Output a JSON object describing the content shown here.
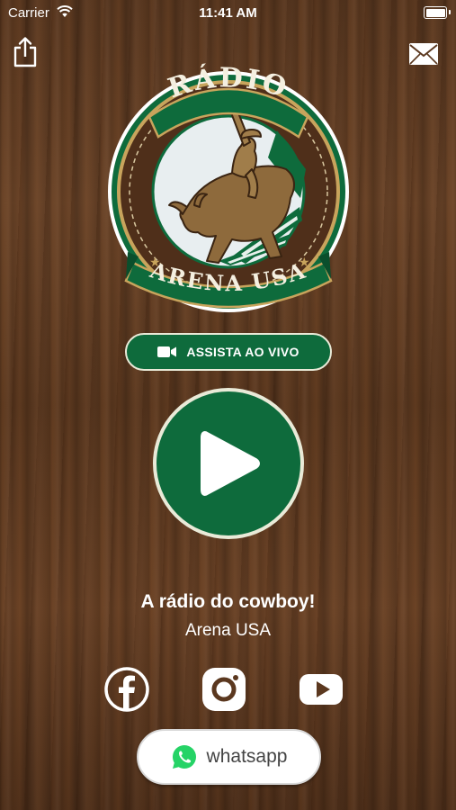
{
  "status_bar": {
    "carrier": "Carrier",
    "time": "11:41 AM"
  },
  "logo": {
    "top_text": "RÁDIO",
    "bottom_text": "ARENA USA"
  },
  "live_button": {
    "label": "ASSISTA AO VIVO",
    "icon": "video-camera-icon"
  },
  "player": {
    "icon": "play-icon"
  },
  "info": {
    "slogan": "A rádio do cowboy!",
    "station": "Arena USA"
  },
  "social": [
    {
      "name": "facebook",
      "icon": "facebook-icon"
    },
    {
      "name": "instagram",
      "icon": "instagram-icon"
    },
    {
      "name": "youtube",
      "icon": "youtube-icon"
    }
  ],
  "whatsapp_button": {
    "label": "whatsapp",
    "icon": "whatsapp-icon"
  },
  "colors": {
    "accent_green": "#0e6b3c",
    "cream": "#e9ead8",
    "gold": "#c8a45c",
    "whatsapp_green": "#25d366"
  }
}
